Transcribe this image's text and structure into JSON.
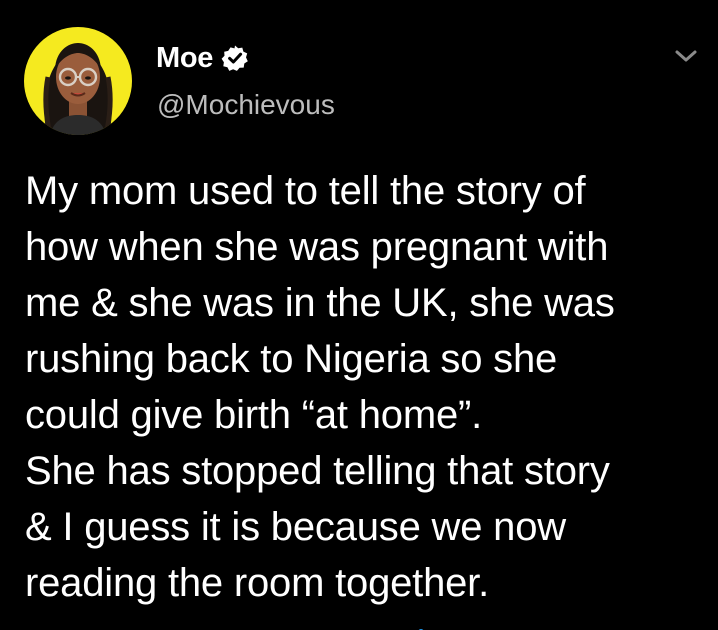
{
  "tweet": {
    "display_name": "Moe",
    "handle": "@Mochievous",
    "verified": true,
    "text": "My mom used to tell the story of\nhow when she was pregnant with\nme & she was in the UK, she was\nrushing back to Nigeria so she\ncould give birth “at home”.\nShe has stopped telling that story\n& I guess it is because we now\nreading the room together."
  },
  "icons": {
    "avatar": "bitmoji-avatar",
    "verified": "verified-badge-icon",
    "menu": "chevron-down-icon"
  },
  "colors": {
    "background": "#000000",
    "text": "#ffffff",
    "handle": "#bdbdbd",
    "avatar_bg": "#f5ea1f",
    "accent": "#1d9bf0"
  }
}
